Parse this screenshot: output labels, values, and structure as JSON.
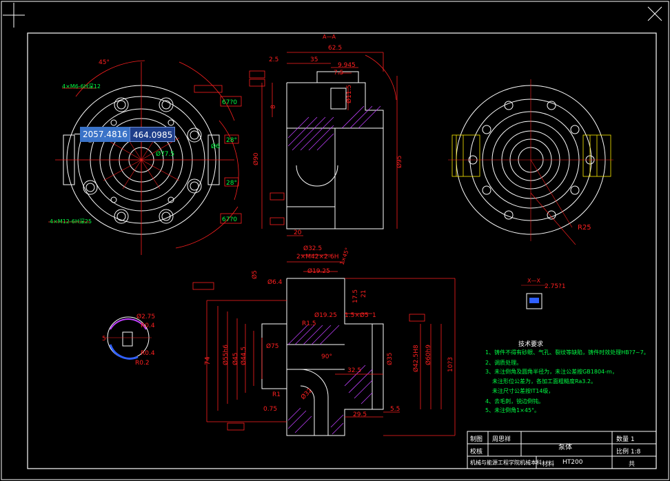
{
  "cursor": {
    "x_readout": "2057.4816",
    "y_readout": "464.0985"
  },
  "colors": {
    "background": "#000000",
    "outline": "#ffffff",
    "dimension": "#ff2020",
    "center": "#ffee00",
    "hatch": "#c040ff",
    "note": "#00ff44",
    "section": "#3060ff"
  },
  "dimensions": {
    "angle_45": "45°",
    "thread_m6": "4×M6-6H深12",
    "thread_m12": "4×M12-6H深25",
    "d67a": "67?0",
    "d67b": "67?0",
    "ang28a": "28°",
    "ang28b": "28°",
    "d77": "Ø77.5",
    "d6": "Ø6",
    "len625": "62.5",
    "len35": "35",
    "len25": "2.5",
    "len9": "9.945",
    "len75": "7.5",
    "d115": "Ø11.5",
    "d95": "Ø95",
    "d90": "Ø90",
    "len8": "8",
    "len20": "20",
    "r25": "R25",
    "d325": "Ø32.5",
    "thread_m42": "2×M42×2-6H",
    "c145": "1×45°",
    "d1925a": "Ø19.25",
    "d1925b": "Ø19.25",
    "d5": "Ø5",
    "d64": "Ø6.4",
    "d15": "1.5×Ø5",
    "len1": "1",
    "r15": "R1.5",
    "r1": "R1",
    "d32": "Ø32",
    "d75": "Ø75",
    "len74": "74",
    "d55": "Ø55h6",
    "d45": "Ø45",
    "d445": "Ø44.5",
    "d35": "Ø35",
    "d425": "Ø42.5H8",
    "d60": "Ø60h9",
    "ang90": "90°",
    "len325": "32.5",
    "len295": "29.5",
    "len55": "5.5",
    "len1053": "10?3",
    "len175": "17.5",
    "len21": "21",
    "len0": "0.75",
    "d275": "Ø2.75",
    "d2751": "2.75?1",
    "r04a": "R0.4",
    "r04b": "R0.4",
    "r02": "R0.2",
    "len5": "5",
    "sec_a": "A—A",
    "sec_x": "X—X"
  },
  "notes": {
    "title": "技术要求",
    "line1": "1、铸件不得有砂眼、气孔、裂纹等缺陷，铸件时效处理HB?7~7。",
    "line2": "2、调质处理。",
    "line3": "3、未注倒角及圆角半径为，未注公差按GB1804-m，",
    "line4": "未注形位公差为，各加工面粗糙度Ra3.2。",
    "line5": "未注尺寸公差按IT14级，",
    "line6": "4、去毛刺，锐边倒钝。",
    "line7": "5、未注倒角1×45°。"
  },
  "title_block": {
    "drawn_label": "制图",
    "drawn_name": "周思祥",
    "check_label": "校核",
    "part_name": "泵体",
    "qty_label": "数量 1",
    "scale_label": "比例 1:8",
    "material_label": "材料",
    "material": "HT200",
    "school": "机械与能源工程学院机械本科",
    "sheet": "共"
  }
}
